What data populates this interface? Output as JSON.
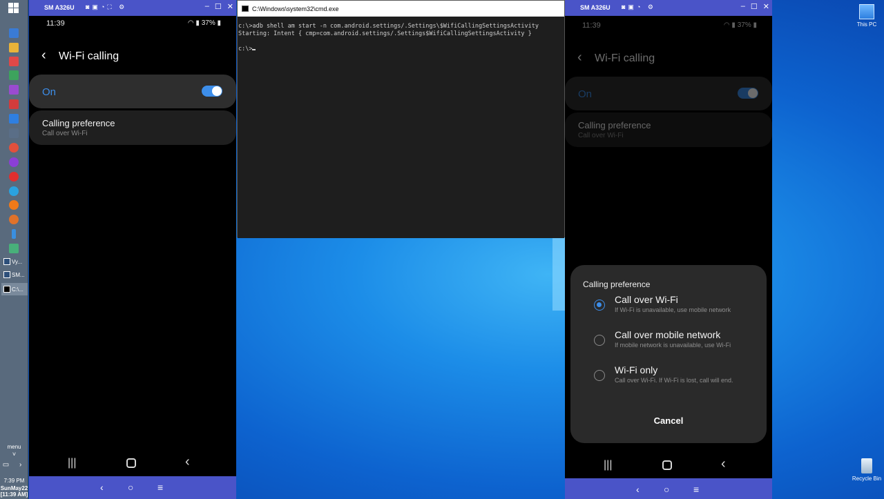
{
  "taskbar": {
    "tasks": [
      {
        "label": "Vy..."
      },
      {
        "label": "SM..."
      },
      {
        "label": "C:\\..."
      }
    ],
    "menu_label": "menu",
    "clock": {
      "time": "7:39 PM",
      "date": "SunMay22",
      "ampm": "[11:39 AM]"
    }
  },
  "phone_left": {
    "title": "SM A326U",
    "time": "11:39",
    "battery": "37%",
    "page_title": "Wi-Fi calling",
    "toggle_label": "On",
    "pref_title": "Calling preference",
    "pref_value": "Call over Wi-Fi"
  },
  "cmd": {
    "title": "C:\\Windows\\system32\\cmd.exe",
    "line1": "c:\\>adb shell am start -n com.android.settings/.Settings\\$WifiCallingSettingsActivity",
    "line2": "Starting: Intent { cmp=com.android.settings/.Settings$WifiCallingSettingsActivity }",
    "line3": "c:\\>"
  },
  "phone_right": {
    "title": "SM A326U",
    "time": "11:39",
    "battery": "37%",
    "page_title": "Wi-Fi calling",
    "toggle_label": "On",
    "pref_title": "Calling preference",
    "pref_value": "Call over Wi-Fi",
    "dialog": {
      "title": "Calling preference",
      "options": [
        {
          "label": "Call over Wi-Fi",
          "desc": "If Wi-Fi is unavailable, use mobile network",
          "selected": true
        },
        {
          "label": "Call over mobile network",
          "desc": "If mobile network is unavailable, use Wi-Fi",
          "selected": false
        },
        {
          "label": "Wi-Fi only",
          "desc": "Call over Wi-Fi. If Wi-Fi is lost, call will end.",
          "selected": false
        }
      ],
      "cancel": "Cancel"
    }
  },
  "desktop": {
    "this_pc": "This PC",
    "recycle_bin": "Recycle Bin"
  },
  "colors": {
    "accent": "#3d8eea",
    "titlebar": "#4a54c8"
  }
}
